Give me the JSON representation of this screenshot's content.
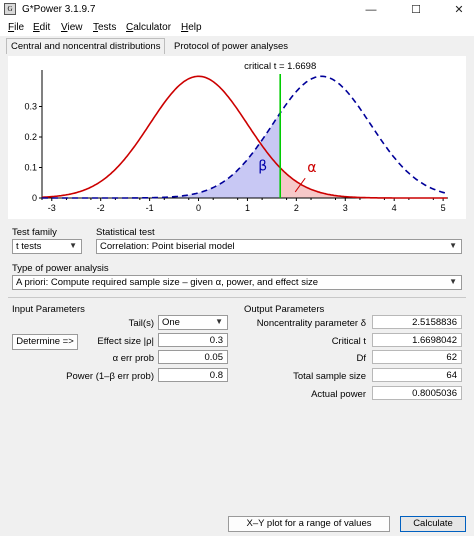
{
  "window": {
    "title": "G*Power 3.1.9.7",
    "app_icon": "G",
    "controls": {
      "minimize": "—",
      "maximize": "☐",
      "close": "✕"
    }
  },
  "menu": [
    {
      "pre": "",
      "ul": "F",
      "post": "ile"
    },
    {
      "pre": "",
      "ul": "E",
      "post": "dit"
    },
    {
      "pre": "",
      "ul": "V",
      "post": "iew"
    },
    {
      "pre": "",
      "ul": "T",
      "post": "ests"
    },
    {
      "pre": "",
      "ul": "C",
      "post": "alculator"
    },
    {
      "pre": "",
      "ul": "H",
      "post": "elp"
    }
  ],
  "tabs": {
    "distributions": "Central and noncentral distributions",
    "protocol": "Protocol of power analyses"
  },
  "chart_data": {
    "type": "line",
    "critical_label": "critical t = 1.6698",
    "critical_value": 1.6698,
    "central_mean": 0,
    "noncentral_mean": 2.5158836,
    "xlim": [
      -3.2,
      5.1
    ],
    "ylim": [
      0,
      0.4
    ],
    "x_ticks": [
      "-3",
      "-2",
      "-1",
      "0",
      "1",
      "2",
      "3",
      "4",
      "5"
    ],
    "x_tick_values": [
      -3,
      -2,
      -1,
      0,
      1,
      2,
      3,
      4,
      5
    ],
    "y_ticks": [
      "0",
      "0.1",
      "0.2",
      "0.3"
    ],
    "y_tick_values": [
      0,
      0.1,
      0.2,
      0.3
    ],
    "beta_label": "β",
    "alpha_label": "α",
    "colors": {
      "central": "#cc0000",
      "noncentral": "#000099",
      "critical": "#00cc00",
      "beta_fill": "#c8c8f4",
      "alpha_fill": "#f6c8c8",
      "beta_text": "#0000aa",
      "alpha_text": "#cc0000"
    }
  },
  "test_family": {
    "label": "Test family",
    "value": "t tests"
  },
  "statistical_test": {
    "label": "Statistical test",
    "value": "Correlation: Point biserial model"
  },
  "power_analysis": {
    "label": "Type of power analysis",
    "value": "A priori: Compute required sample size – given α, power, and effect size"
  },
  "input": {
    "title": "Input Parameters",
    "tails_label": "Tail(s)",
    "tails_value": "One",
    "determine_label": "Determine =>",
    "effect_label": "Effect size |ρ|",
    "effect_value": "0.3",
    "alpha_label": "α err prob",
    "alpha_value": "0.05",
    "power_label": "Power (1–β err prob)",
    "power_value": "0.8"
  },
  "output": {
    "title": "Output Parameters",
    "rows": [
      {
        "label": "Noncentrality parameter δ",
        "value": "2.5158836"
      },
      {
        "label": "Critical t",
        "value": "1.6698042"
      },
      {
        "label": "Df",
        "value": "62"
      },
      {
        "label": "Total sample size",
        "value": "64"
      },
      {
        "label": "Actual power",
        "value": "0.8005036"
      }
    ]
  },
  "footer": {
    "xy_plot_label": "X–Y plot for a range of values",
    "calculate_label": "Calculate"
  }
}
